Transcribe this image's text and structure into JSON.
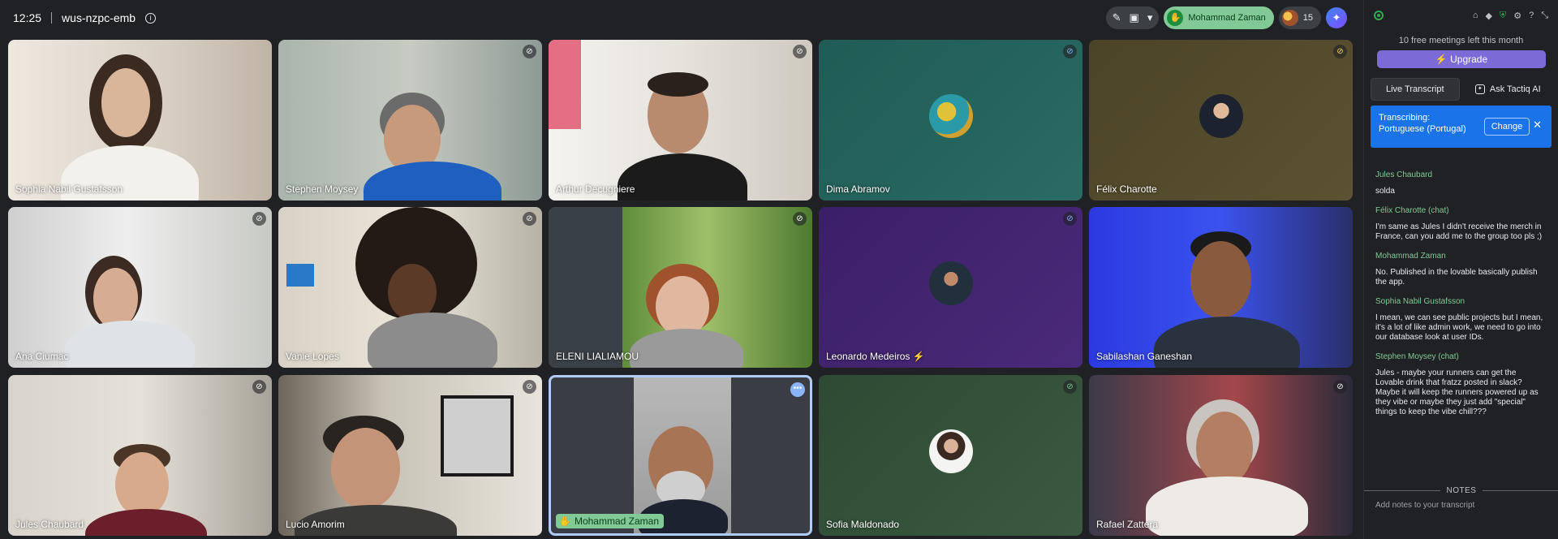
{
  "topbar": {
    "time": "12:25",
    "meeting_code": "wus-nzpc-emb",
    "user_pill_name": "Mohammad Zaman",
    "participant_count": "15"
  },
  "tiles": [
    {
      "name": "Sophia Nabil Gustafsson"
    },
    {
      "name": "Stephen Moysey"
    },
    {
      "name": "Arthur Decugniere"
    },
    {
      "name": "Dima Abramov"
    },
    {
      "name": "Félix Charotte"
    },
    {
      "name": "Ana Ciumac"
    },
    {
      "name": "Vanie Lopes"
    },
    {
      "name": "ELENI LIALIAMOU"
    },
    {
      "name": "Leonardo Medeiros ⚡"
    },
    {
      "name": "Sabilashan Ganeshan"
    },
    {
      "name": "Jules Chaubard"
    },
    {
      "name": "Lucio Amorim"
    },
    {
      "name": "Mohammad Zaman"
    },
    {
      "name": "Sofia Maldonado"
    },
    {
      "name": "Rafael Zattera"
    }
  ],
  "panel": {
    "free_note": "10 free meetings left this month",
    "upgrade_label": "⚡ Upgrade",
    "tab_live": "Live Transcript",
    "tab_ai": "Ask Tactiq AI",
    "banner_text_1": "Transcribing:",
    "banner_text_2": "Portuguese (Portugal)",
    "change_label": "Change",
    "transcript": [
      {
        "speaker": "Jules Chaubard",
        "msg": "solda"
      },
      {
        "speaker": "Félix Charotte (chat)",
        "msg": "I'm same as Jules I didn't receive the merch in France, can you add me to the group too pls ;)"
      },
      {
        "speaker": "Mohammad Zaman",
        "msg": "No. Published in the lovable basically publish the app."
      },
      {
        "speaker": "Sophia Nabil Gustafsson",
        "msg": "I mean, we can see public projects but I mean, it's a lot of like admin work, we need to go into our database look at user IDs."
      },
      {
        "speaker": "Stephen Moysey (chat)",
        "msg": "Jules - maybe your runners can get the Lovable drink that fratzz posted in slack? Maybe it will keep the runners powered up as they vibe or maybe they just add \"special\" things to keep the vibe chill???"
      }
    ],
    "notes_label": "NOTES",
    "notes_placeholder": "Add notes to your transcript"
  }
}
